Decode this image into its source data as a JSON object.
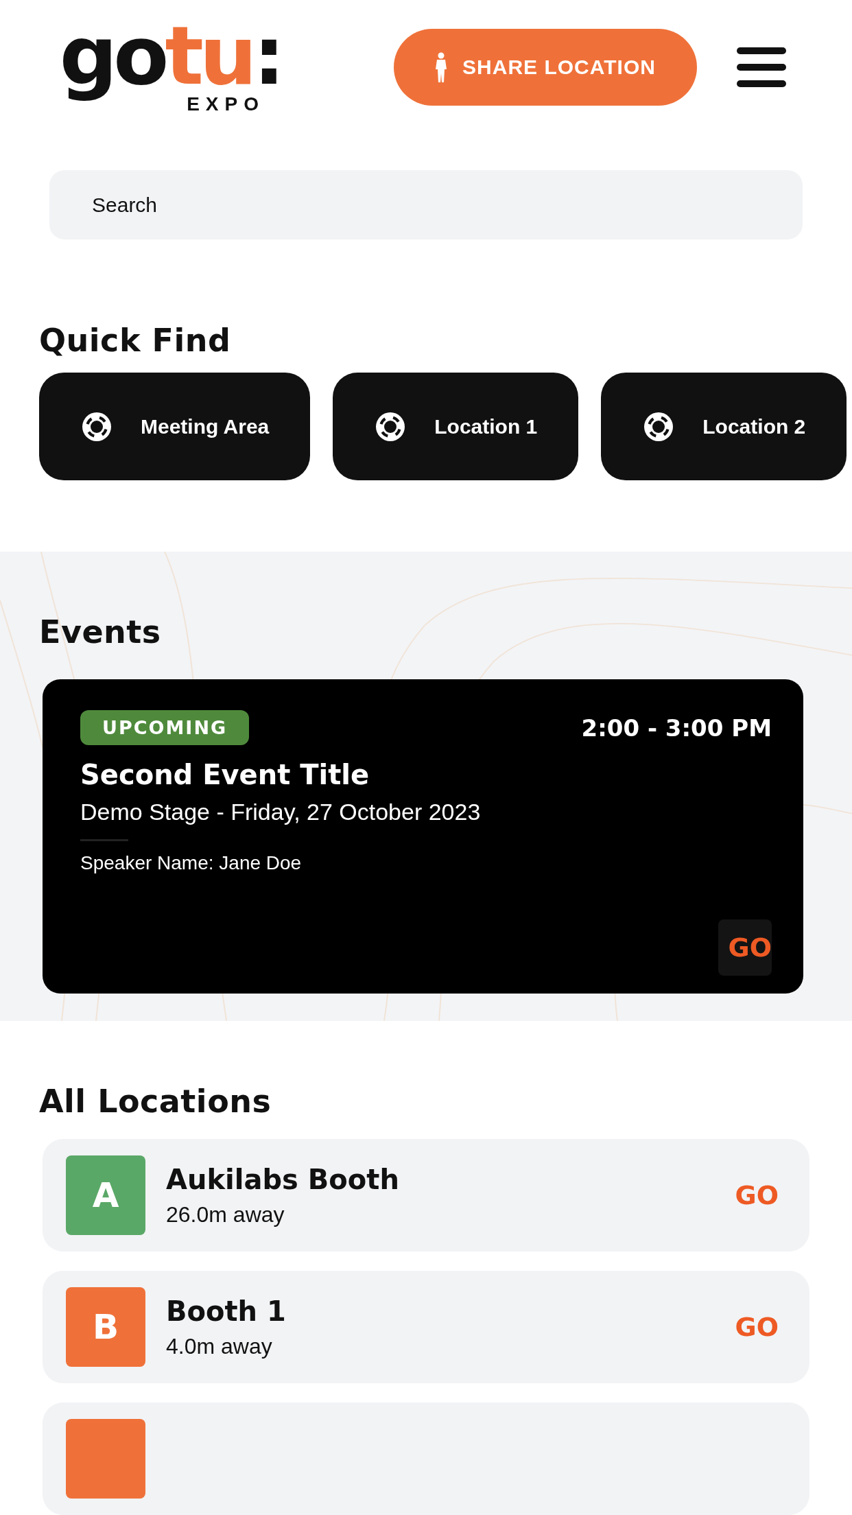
{
  "header": {
    "logo": {
      "word_dark": "go",
      "word_accent": "tu",
      "colon": ":",
      "subtitle": "EXPO"
    },
    "share_button": "SHARE LOCATION"
  },
  "search": {
    "placeholder": "Search"
  },
  "quick_find": {
    "title": "Quick Find",
    "items": [
      {
        "label": "Meeting Area"
      },
      {
        "label": "Location 1"
      },
      {
        "label": "Location 2"
      }
    ]
  },
  "events": {
    "title": "Events",
    "items": [
      {
        "status": "UPCOMING",
        "time": "2:00 - 3:00 PM",
        "title": "Second Event Title",
        "subtitle": "Demo Stage - Friday, 27 October 2023",
        "speaker": "Speaker Name: Jane Doe",
        "action": "GO"
      }
    ]
  },
  "locations": {
    "title": "All Locations",
    "items": [
      {
        "letter": "A",
        "color": "#5aa867",
        "name": "Aukilabs Booth",
        "distance": "26.0m away",
        "action": "GO"
      },
      {
        "letter": "B",
        "color": "#ef7139",
        "name": "Booth 1",
        "distance": "4.0m away",
        "action": "GO"
      },
      {
        "color": "#ef7139"
      }
    ]
  }
}
